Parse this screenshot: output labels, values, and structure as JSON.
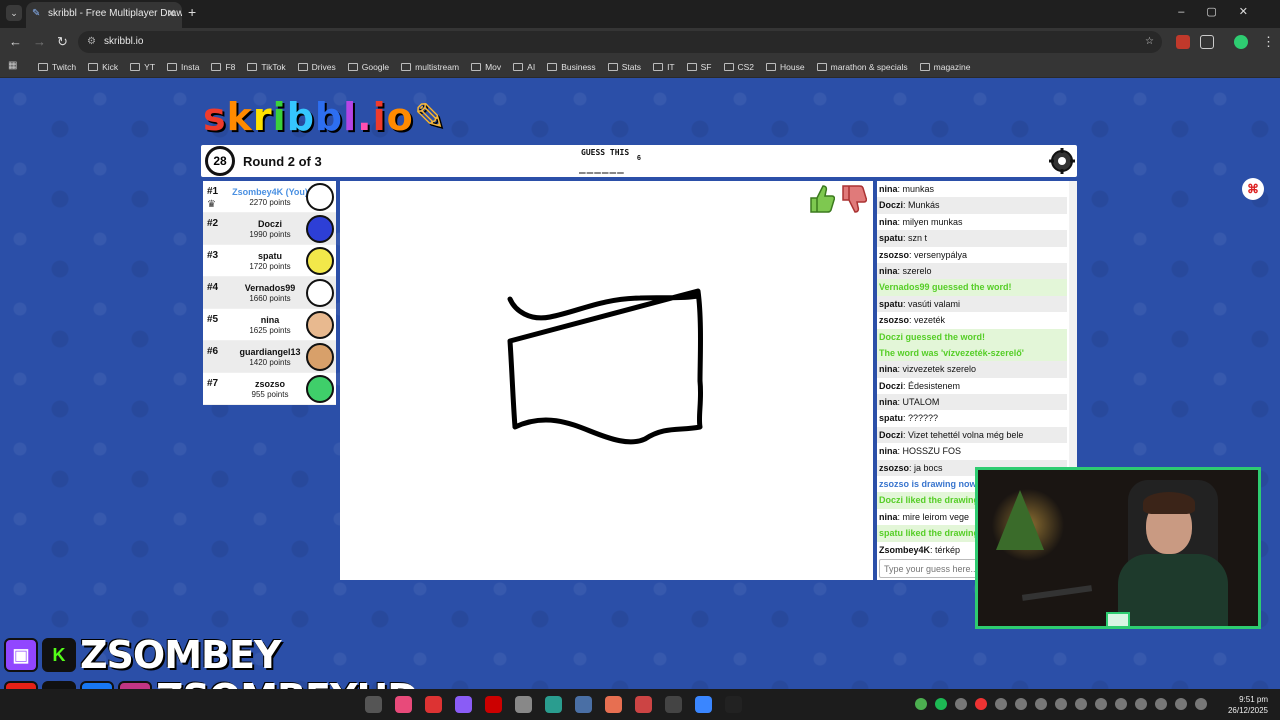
{
  "browser": {
    "tab_title": "skribbl - Free Multiplayer Drawi",
    "url": "skribbl.io",
    "bookmarks": [
      "Twitch",
      "Kick",
      "YT",
      "Insta",
      "F8",
      "TikTok",
      "Drives",
      "Google",
      "multistream",
      "Mov",
      "AI",
      "Business",
      "Stats",
      "IT",
      "SF",
      "CS2",
      "House",
      "marathon & specials",
      "magazine"
    ]
  },
  "game": {
    "logo": "skribbl.io",
    "timer": "28",
    "round": "Round 2 of 3",
    "guess_label": "GUESS THIS",
    "word_blanks": "______",
    "word_length": "6",
    "chat_placeholder": "Type your guess here..."
  },
  "players": [
    {
      "rank": "#1",
      "name": "Zsombey4K (You)",
      "points": "2270 points",
      "you": true,
      "avatar_color": "#ffffff"
    },
    {
      "rank": "#2",
      "name": "Doczi",
      "points": "1990 points",
      "you": false,
      "avatar_color": "#2d3fd6"
    },
    {
      "rank": "#3",
      "name": "spatu",
      "points": "1720 points",
      "you": false,
      "avatar_color": "#f2e84a"
    },
    {
      "rank": "#4",
      "name": "Vernados99",
      "points": "1660 points",
      "you": false,
      "avatar_color": "#ffffff"
    },
    {
      "rank": "#5",
      "name": "nina",
      "points": "1625 points",
      "you": false,
      "avatar_color": "#e8b98f"
    },
    {
      "rank": "#6",
      "name": "guardiangel13",
      "points": "1420 points",
      "you": false,
      "avatar_color": "#d8a06a"
    },
    {
      "rank": "#7",
      "name": "zsozso",
      "points": "955 points",
      "you": false,
      "avatar_color": "#3fcf6a"
    }
  ],
  "chat": [
    {
      "user": "nina",
      "text": "munkas",
      "type": "normal"
    },
    {
      "user": "Doczi",
      "text": "Munkás",
      "type": "normal"
    },
    {
      "user": "nina",
      "text": "milyen munkas",
      "type": "normal"
    },
    {
      "user": "spatu",
      "text": "szn t",
      "type": "normal"
    },
    {
      "user": "zsozso",
      "text": "versenypálya",
      "type": "normal"
    },
    {
      "user": "nina",
      "text": "szerelo",
      "type": "normal"
    },
    {
      "user": "",
      "text": "Vernados99 guessed the word!",
      "type": "green"
    },
    {
      "user": "spatu",
      "text": "vasúti valami",
      "type": "normal"
    },
    {
      "user": "zsozso",
      "text": "vezeték",
      "type": "normal"
    },
    {
      "user": "",
      "text": "Doczi guessed the word!",
      "type": "green"
    },
    {
      "user": "",
      "text": "The word was 'vízvezeték-szerelő'",
      "type": "green"
    },
    {
      "user": "nina",
      "text": "vizvezetek szerelo",
      "type": "normal"
    },
    {
      "user": "Doczi",
      "text": "Édesistenem",
      "type": "normal"
    },
    {
      "user": "nina",
      "text": "UTALOM",
      "type": "normal"
    },
    {
      "user": "spatu",
      "text": "??????",
      "type": "normal"
    },
    {
      "user": "Doczi",
      "text": "Vizet tehettél volna még bele",
      "type": "normal"
    },
    {
      "user": "nina",
      "text": "HOSSZU FOS",
      "type": "normal"
    },
    {
      "user": "zsozso",
      "text": "ja bocs",
      "type": "normal"
    },
    {
      "user": "",
      "text": "zsozso is drawing now!",
      "type": "blue"
    },
    {
      "user": "",
      "text": "Doczi liked the drawing!",
      "type": "green"
    },
    {
      "user": "nina",
      "text": "mire leirom vege",
      "type": "normal"
    },
    {
      "user": "",
      "text": "spatu liked the drawing!",
      "type": "green"
    },
    {
      "user": "Zsombey4K",
      "text": "térkép",
      "type": "normal"
    }
  ],
  "overlay": {
    "handle1": "ZSOMBEY",
    "handle2": "ZSOMBEYHD"
  },
  "taskbar": {
    "time": "9:51 pm",
    "date": "26/12/2025"
  },
  "colors": {
    "background": "#2b4fa8",
    "webcam_border": "#2ecc71",
    "guess_green": "#56ce27",
    "system_blue": "#3975ce"
  }
}
